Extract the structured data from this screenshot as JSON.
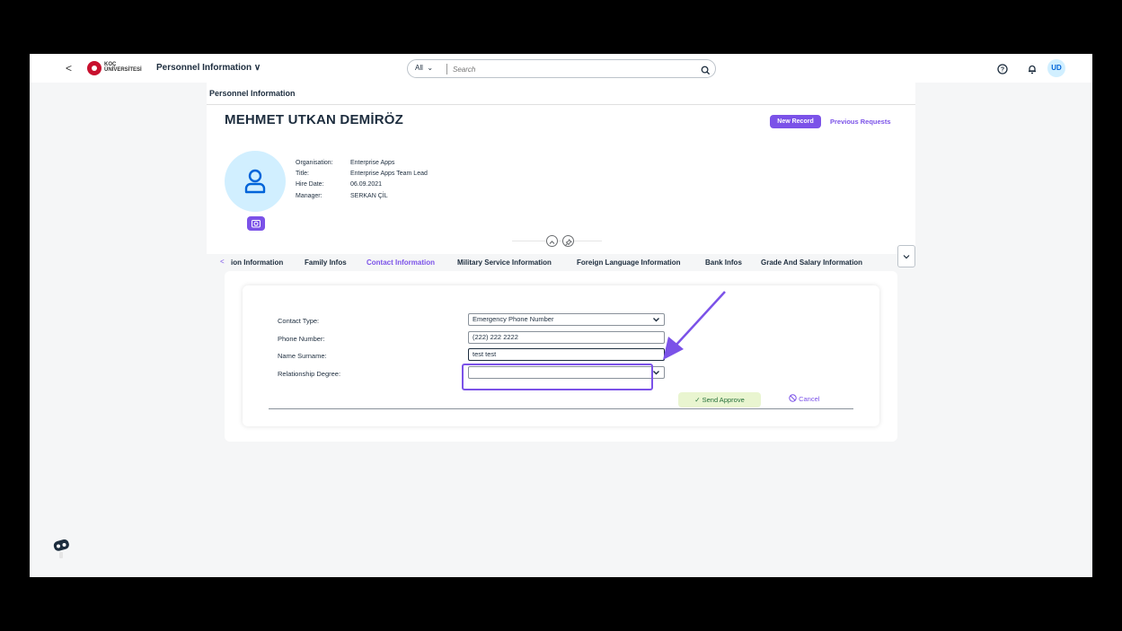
{
  "shell": {
    "back_label": "<",
    "logo_text": "KOÇ ÜNİVERSİTESİ",
    "app_title": "Personnel Information ∨",
    "search_scope": "All",
    "search_placeholder": "Search",
    "user_initials": "UD"
  },
  "page": {
    "title": "Personnel Information"
  },
  "employee": {
    "name": "MEHMET UTKAN DEMİRÖZ",
    "labels": [
      "Organisation:",
      "Title:",
      "Hire Date:",
      "Manager:"
    ],
    "organisation": "Enterprise Apps",
    "title": "Enterprise Apps Team Lead",
    "hire_date": "06.09.2021",
    "manager": "SERKAN ÇİL"
  },
  "actions": {
    "new_record": "New Record",
    "previous_requests": "Previous Requests"
  },
  "tabs": [
    {
      "label": "ion Information"
    },
    {
      "label": "Family Infos"
    },
    {
      "label": "Contact Information",
      "active": true
    },
    {
      "label": "Military Service Information"
    },
    {
      "label": "Foreign Language Information"
    },
    {
      "label": "Bank Infos"
    },
    {
      "label": "Grade And Salary Information"
    }
  ],
  "form": {
    "contact_type_label": "Contact Type:",
    "contact_type_value": "Emergency Phone Number",
    "phone_label": "Phone Number:",
    "phone_value": "(222) 222 2222",
    "name_label": "Name Surname:",
    "name_value": "test test",
    "relationship_label": "Relationship Degree:",
    "relationship_value": "",
    "send_label": "Send Approve",
    "cancel_label": "Cancel"
  },
  "colors": {
    "accent": "#7b52e8",
    "send_bg": "#e9f5d0"
  }
}
